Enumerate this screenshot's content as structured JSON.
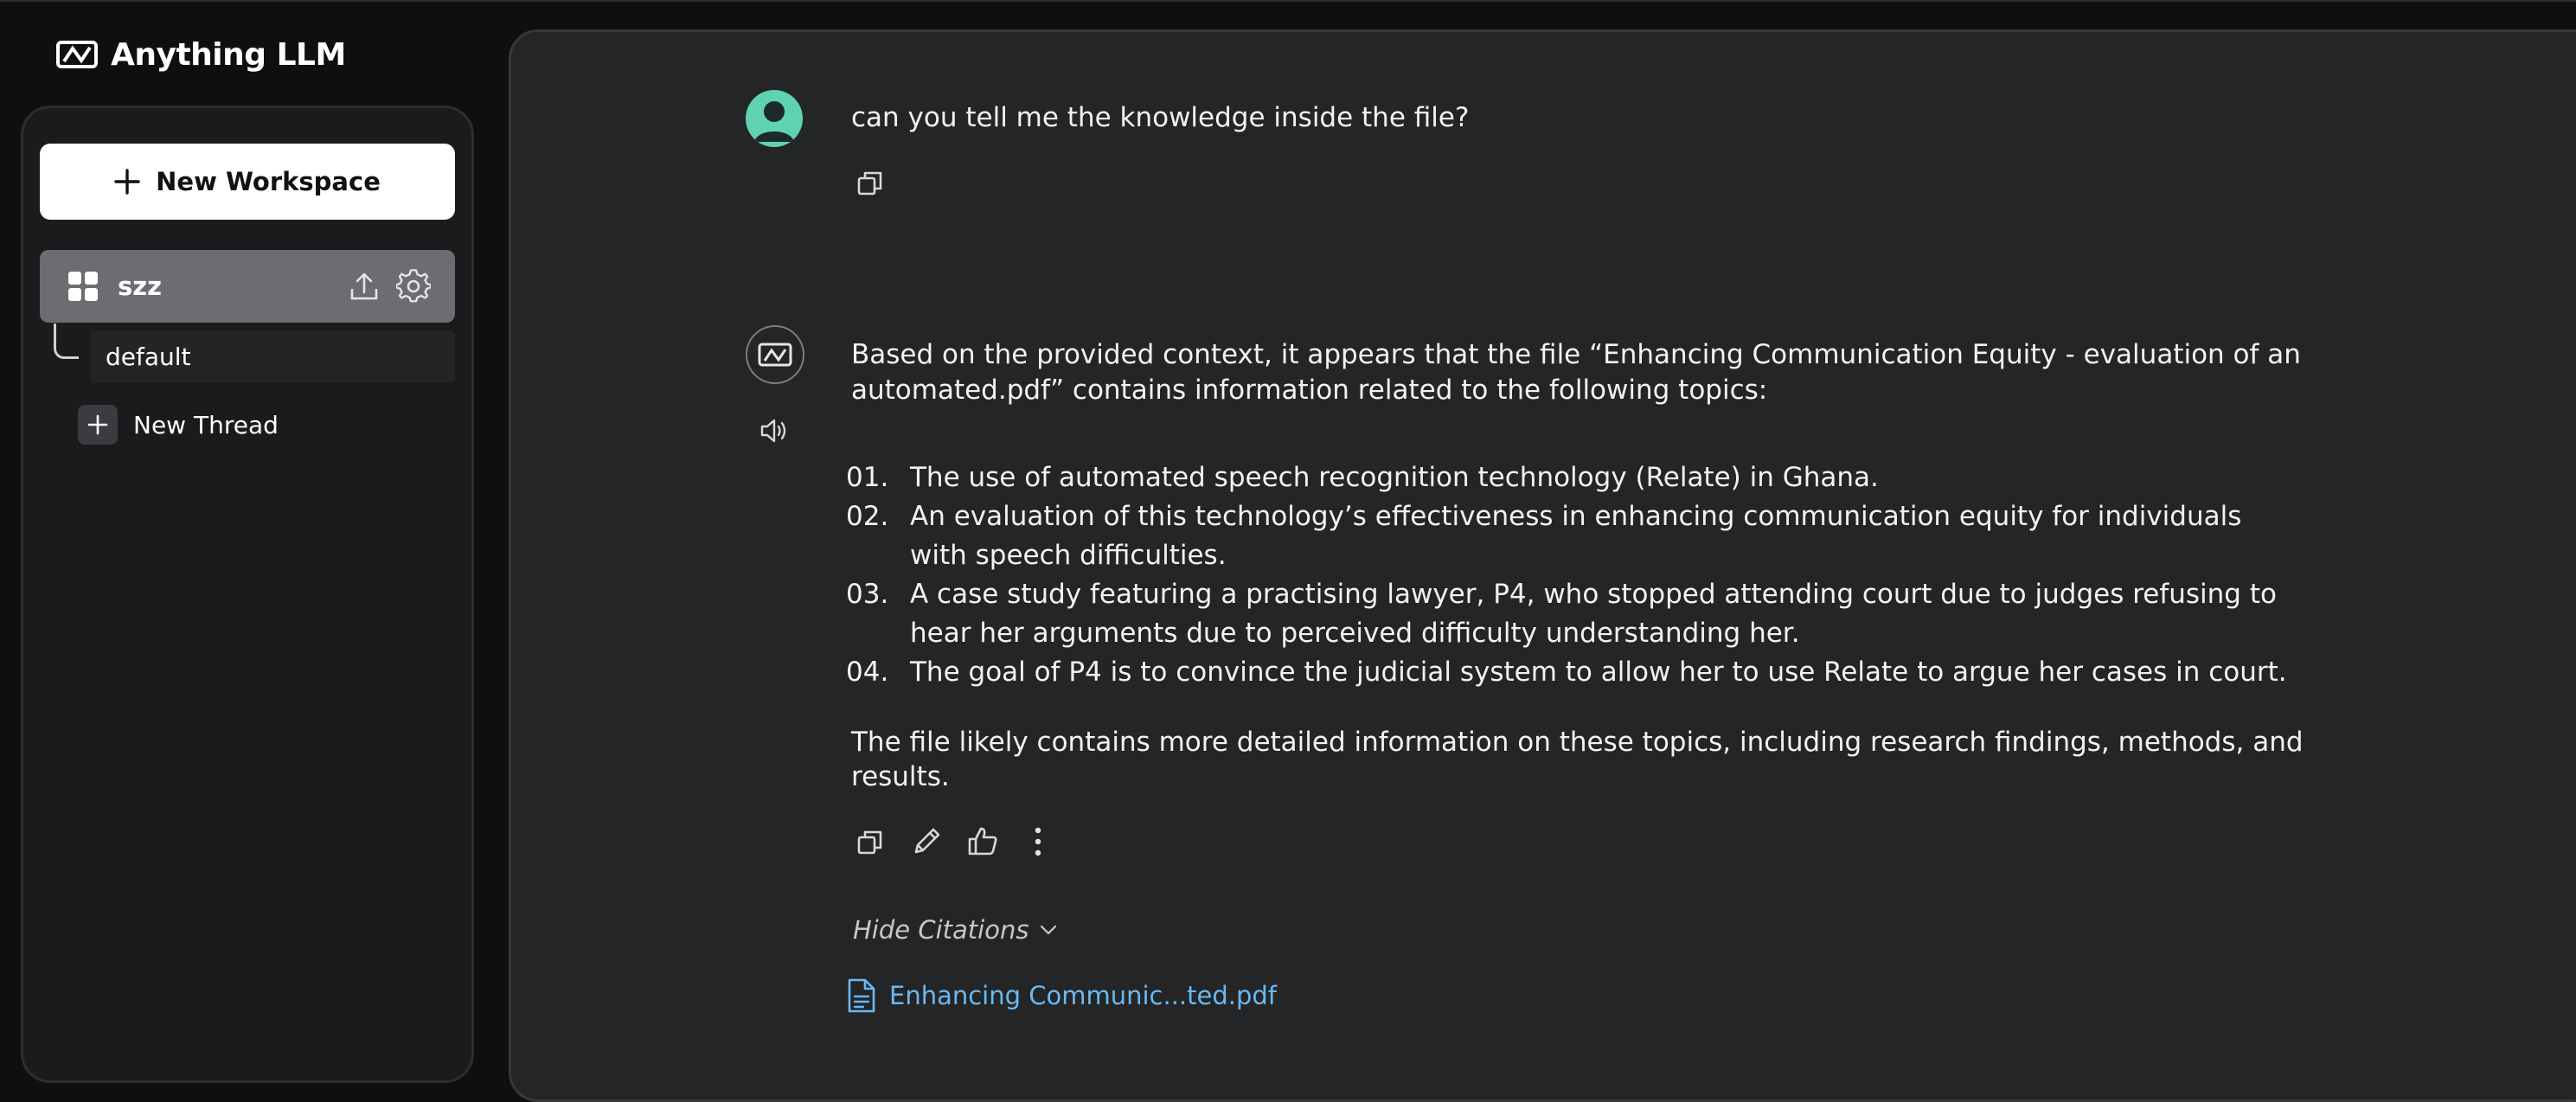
{
  "app": {
    "title": "Anything LLM"
  },
  "sidebar": {
    "new_workspace_label": "New Workspace",
    "workspace": {
      "name": "szz"
    },
    "threads": [
      {
        "label": "default"
      }
    ],
    "new_thread_label": "New Thread"
  },
  "chat": {
    "user_message": "can you tell me the knowledge inside the file?",
    "assistant": {
      "intro_line1": "Based on the provided context, it appears that the file “Enhancing Communication Equity - evaluation of an",
      "intro_line2": "automated.pdf” contains information related to the following topics:",
      "items": [
        {
          "num": "01.",
          "text": "The use of automated speech recognition technology (Relate) in Ghana."
        },
        {
          "num": "02.",
          "text": "An evaluation of this technology’s effectiveness in enhancing communication equity for individuals with speech difficulties."
        },
        {
          "num": "03.",
          "text": "A case study featuring a practising lawyer, P4, who stopped attending court due to judges refusing to hear her arguments due to perceived difficulty understanding her."
        },
        {
          "num": "04.",
          "text": "The goal of P4 is to convince the judicial system to allow her to use Relate to argue her cases in court."
        }
      ],
      "outro_line1": "The file likely contains more detailed information on these topics, including research findings, methods, and",
      "outro_line2": "results."
    },
    "hide_citations_label": "Hide Citations",
    "citation_file": "Enhancing Communic...ted.pdf"
  },
  "colors": {
    "background": "#0e0f0f",
    "panel": "#242527",
    "accent_avatar": "#5fd3b0",
    "citation_link": "#6bb8f0"
  }
}
